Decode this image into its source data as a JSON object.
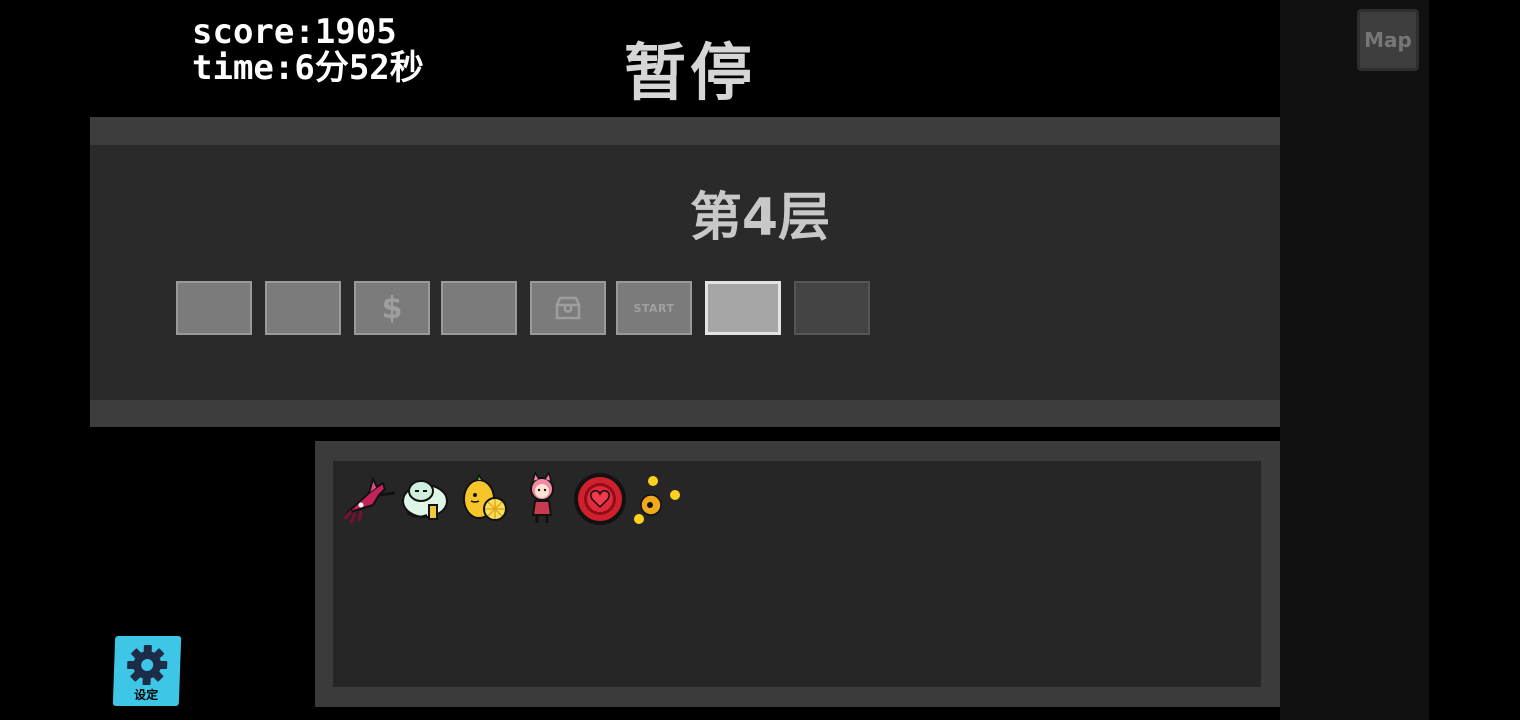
{
  "hud": {
    "score": "score:1905",
    "time": "time:6分52秒"
  },
  "pause_title": "暂停",
  "floor": {
    "label": "第4层",
    "rooms": [
      {
        "type": "empty",
        "state": "visited"
      },
      {
        "type": "empty",
        "state": "visited"
      },
      {
        "type": "shop",
        "icon": "dollar-icon",
        "state": "visited"
      },
      {
        "type": "empty",
        "state": "visited"
      },
      {
        "type": "treasure",
        "icon": "chest-icon",
        "state": "visited"
      },
      {
        "type": "start",
        "label": "START",
        "state": "visited"
      },
      {
        "type": "empty",
        "state": "current"
      },
      {
        "type": "empty",
        "state": "unvisited"
      }
    ]
  },
  "map_button": {
    "label": "Map"
  },
  "inventory": {
    "items": [
      {
        "icon": "squid-icon"
      },
      {
        "icon": "sleeping-creature-icon"
      },
      {
        "icon": "lemon-icon"
      },
      {
        "icon": "pink-hair-girl-icon"
      },
      {
        "icon": "heart-target-icon"
      },
      {
        "icon": "orbiting-orbs-icon"
      }
    ]
  },
  "settings": {
    "label": "设定"
  },
  "colors": {
    "background": "#000000",
    "panel": "#2a2a2a",
    "panel_band": "#3d3d3d",
    "settings_accent": "#3ec6e6",
    "current_room": "#a6a6a6"
  }
}
